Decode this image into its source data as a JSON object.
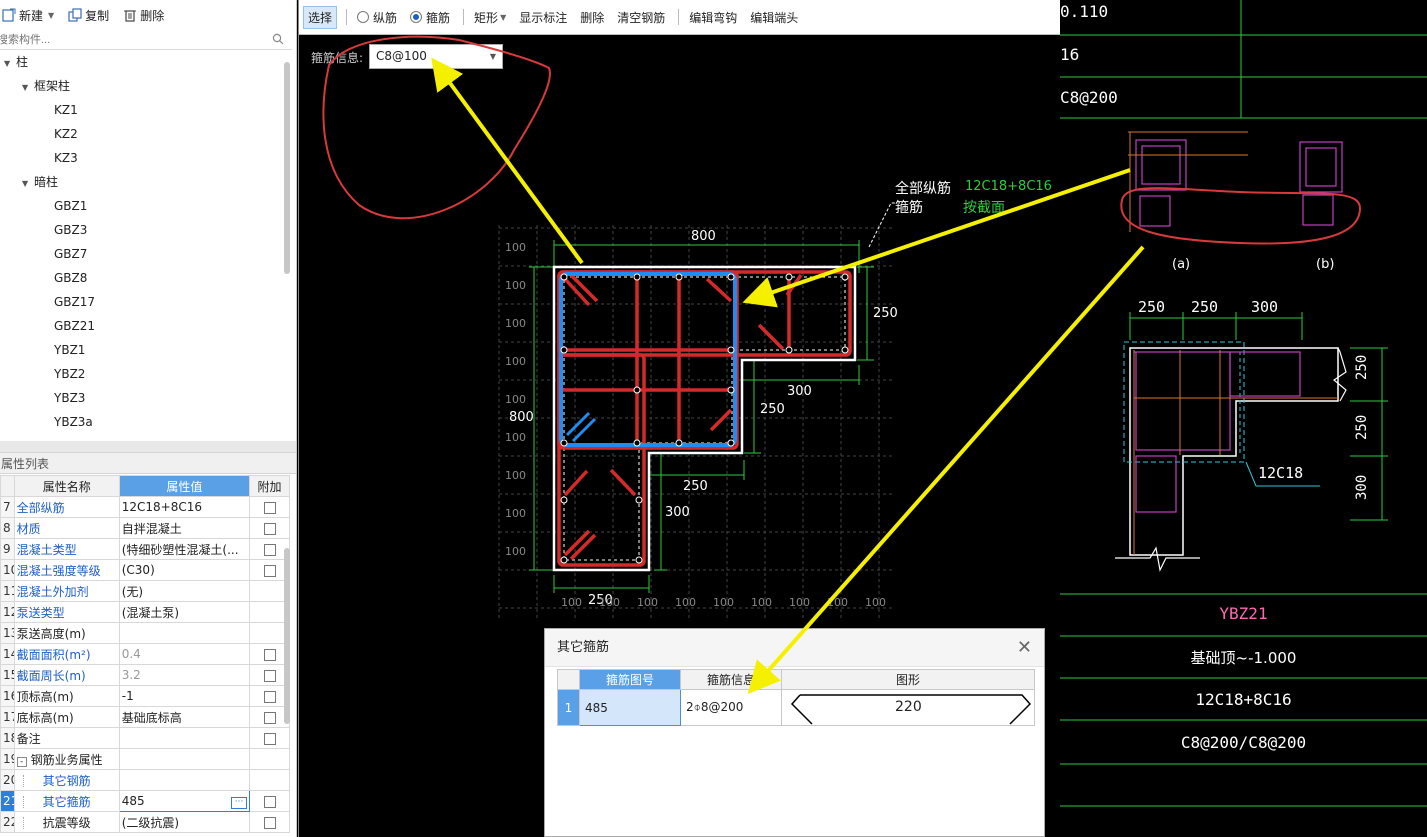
{
  "toolbar": {
    "new_label": "新建",
    "copy_label": "复制",
    "delete_label": "删除"
  },
  "search": {
    "placeholder": "搜索构件..."
  },
  "tree": {
    "root": "柱",
    "groups": [
      {
        "label": "框架柱",
        "items": [
          "KZ1",
          "KZ2",
          "KZ3"
        ]
      },
      {
        "label": "暗柱",
        "items": [
          "GBZ1",
          "GBZ3",
          "GBZ7",
          "GBZ8",
          "GBZ17",
          "GBZ21",
          "YBZ1",
          "YBZ2",
          "YBZ3",
          "YBZ3a"
        ]
      }
    ]
  },
  "props": {
    "title": "属性列表",
    "headers": {
      "name": "属性名称",
      "value": "属性值",
      "extra": "附加"
    },
    "rows": [
      {
        "num": "7",
        "name": "全部纵筋",
        "value": "12C18+8C16",
        "blue": true,
        "check": true
      },
      {
        "num": "8",
        "name": "材质",
        "value": "自拌混凝土",
        "blue": true,
        "check": true
      },
      {
        "num": "9",
        "name": "混凝土类型",
        "value": "(特细砂塑性混凝土(...",
        "blue": true,
        "check": true
      },
      {
        "num": "10",
        "name": "混凝土强度等级",
        "value": "(C30)",
        "blue": true,
        "check": true
      },
      {
        "num": "11",
        "name": "混凝土外加剂",
        "value": "(无)",
        "blue": true,
        "check": false
      },
      {
        "num": "12",
        "name": "泵送类型",
        "value": "(混凝土泵)",
        "blue": true,
        "check": false
      },
      {
        "num": "13",
        "name": "泵送高度(m)",
        "value": "",
        "blue": false,
        "check": false
      },
      {
        "num": "14",
        "name": "截面面积(m²)",
        "value": "0.4",
        "blue": true,
        "gray": true,
        "check": true
      },
      {
        "num": "15",
        "name": "截面周长(m)",
        "value": "3.2",
        "blue": true,
        "gray": true,
        "check": true
      },
      {
        "num": "16",
        "name": "顶标高(m)",
        "value": "-1",
        "blue": false,
        "check": true
      },
      {
        "num": "17",
        "name": "底标高(m)",
        "value": "基础底标高",
        "blue": false,
        "check": true
      },
      {
        "num": "18",
        "name": "备注",
        "value": "",
        "blue": false,
        "check": true
      },
      {
        "num": "19",
        "name": "钢筋业务属性",
        "value": "",
        "blue": false,
        "check": false,
        "expand": "-"
      },
      {
        "num": "20",
        "name": "其它钢筋",
        "value": "",
        "blue": true,
        "check": false,
        "indent": true
      },
      {
        "num": "21",
        "name": "其它箍筋",
        "value": "485",
        "blue": true,
        "check": true,
        "indent": true,
        "selected": true
      },
      {
        "num": "22",
        "name": "抗震等级",
        "value": "(二级抗震)",
        "blue": false,
        "check": true,
        "indent": true
      }
    ]
  },
  "editor_toolbar": {
    "select": "选择",
    "longitudinal": "纵筋",
    "stirrup": "箍筋",
    "rect": "矩形",
    "show_label": "显示标注",
    "delete": "删除",
    "clear": "清空钢筋",
    "edit_hook": "编辑弯钩",
    "edit_end": "编辑端头"
  },
  "stirrup_info": {
    "label": "箍筋信息:",
    "value": "C8@100"
  },
  "section": {
    "all_bars_label": "全部纵筋",
    "all_bars_value": "12C18+8C16",
    "stirrup_label": "箍筋",
    "stirrup_value": "按截面",
    "dim_800_top": "800",
    "dim_800_left": "800",
    "dim_250_right": "250",
    "dim_300_mid": "300",
    "dim_250_mid": "250",
    "dim_250_inner": "250",
    "dim_300_low": "300",
    "dim_250_bottom": "250",
    "grid_label": "100"
  },
  "dialog": {
    "title": "其它箍筋",
    "headers": {
      "no": "箍筋图号",
      "info": "箍筋信息",
      "shape": "图形"
    },
    "rows": [
      {
        "index": "1",
        "no": "485",
        "info": "2⌽8@200",
        "shape_value": "220"
      }
    ]
  },
  "cad": {
    "top_value": "0.110",
    "top_value2": "16",
    "top_value3": "C8@200",
    "label_a": "(a)",
    "label_b": "(b)",
    "dims_top": [
      "250",
      "250",
      "300"
    ],
    "dims_right": [
      "250",
      "250",
      "300"
    ],
    "bar_label": "12C18",
    "name": "YBZ21",
    "elevation": "基础顶~-1.000",
    "bars": "12C18+8C16",
    "stirrups": "C8@200/C8@200"
  }
}
